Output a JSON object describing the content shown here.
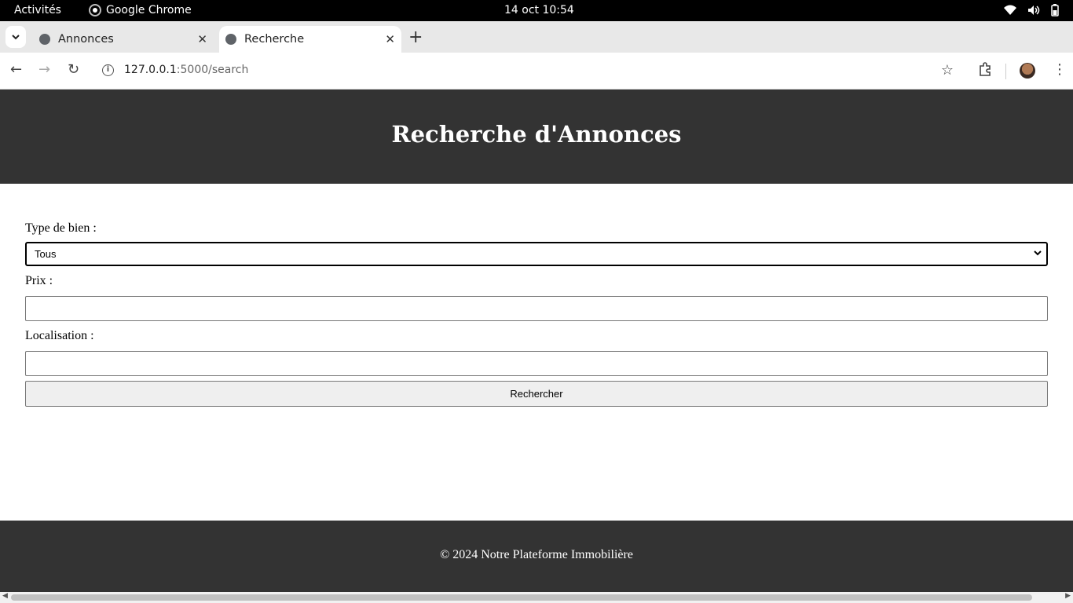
{
  "system": {
    "activities": "Activités",
    "app_name": "Google Chrome",
    "clock": "14 oct  10:54"
  },
  "browser": {
    "tabs": [
      {
        "title": "Annonces",
        "active": false
      },
      {
        "title": "Recherche",
        "active": true
      }
    ],
    "url_host": "127.0.0.1",
    "url_rest": ":5000/search"
  },
  "page": {
    "title": "Recherche d'Annonces",
    "form": {
      "type_label": "Type de bien :",
      "type_value": "Tous",
      "prix_label": "Prix :",
      "prix_value": "",
      "localisation_label": "Localisation :",
      "localisation_value": "",
      "submit_label": "Rechercher"
    },
    "footer": "© 2024 Notre Plateforme Immobilière"
  },
  "colors": {
    "header_bg": "#333333",
    "footer_bg": "#333333"
  }
}
